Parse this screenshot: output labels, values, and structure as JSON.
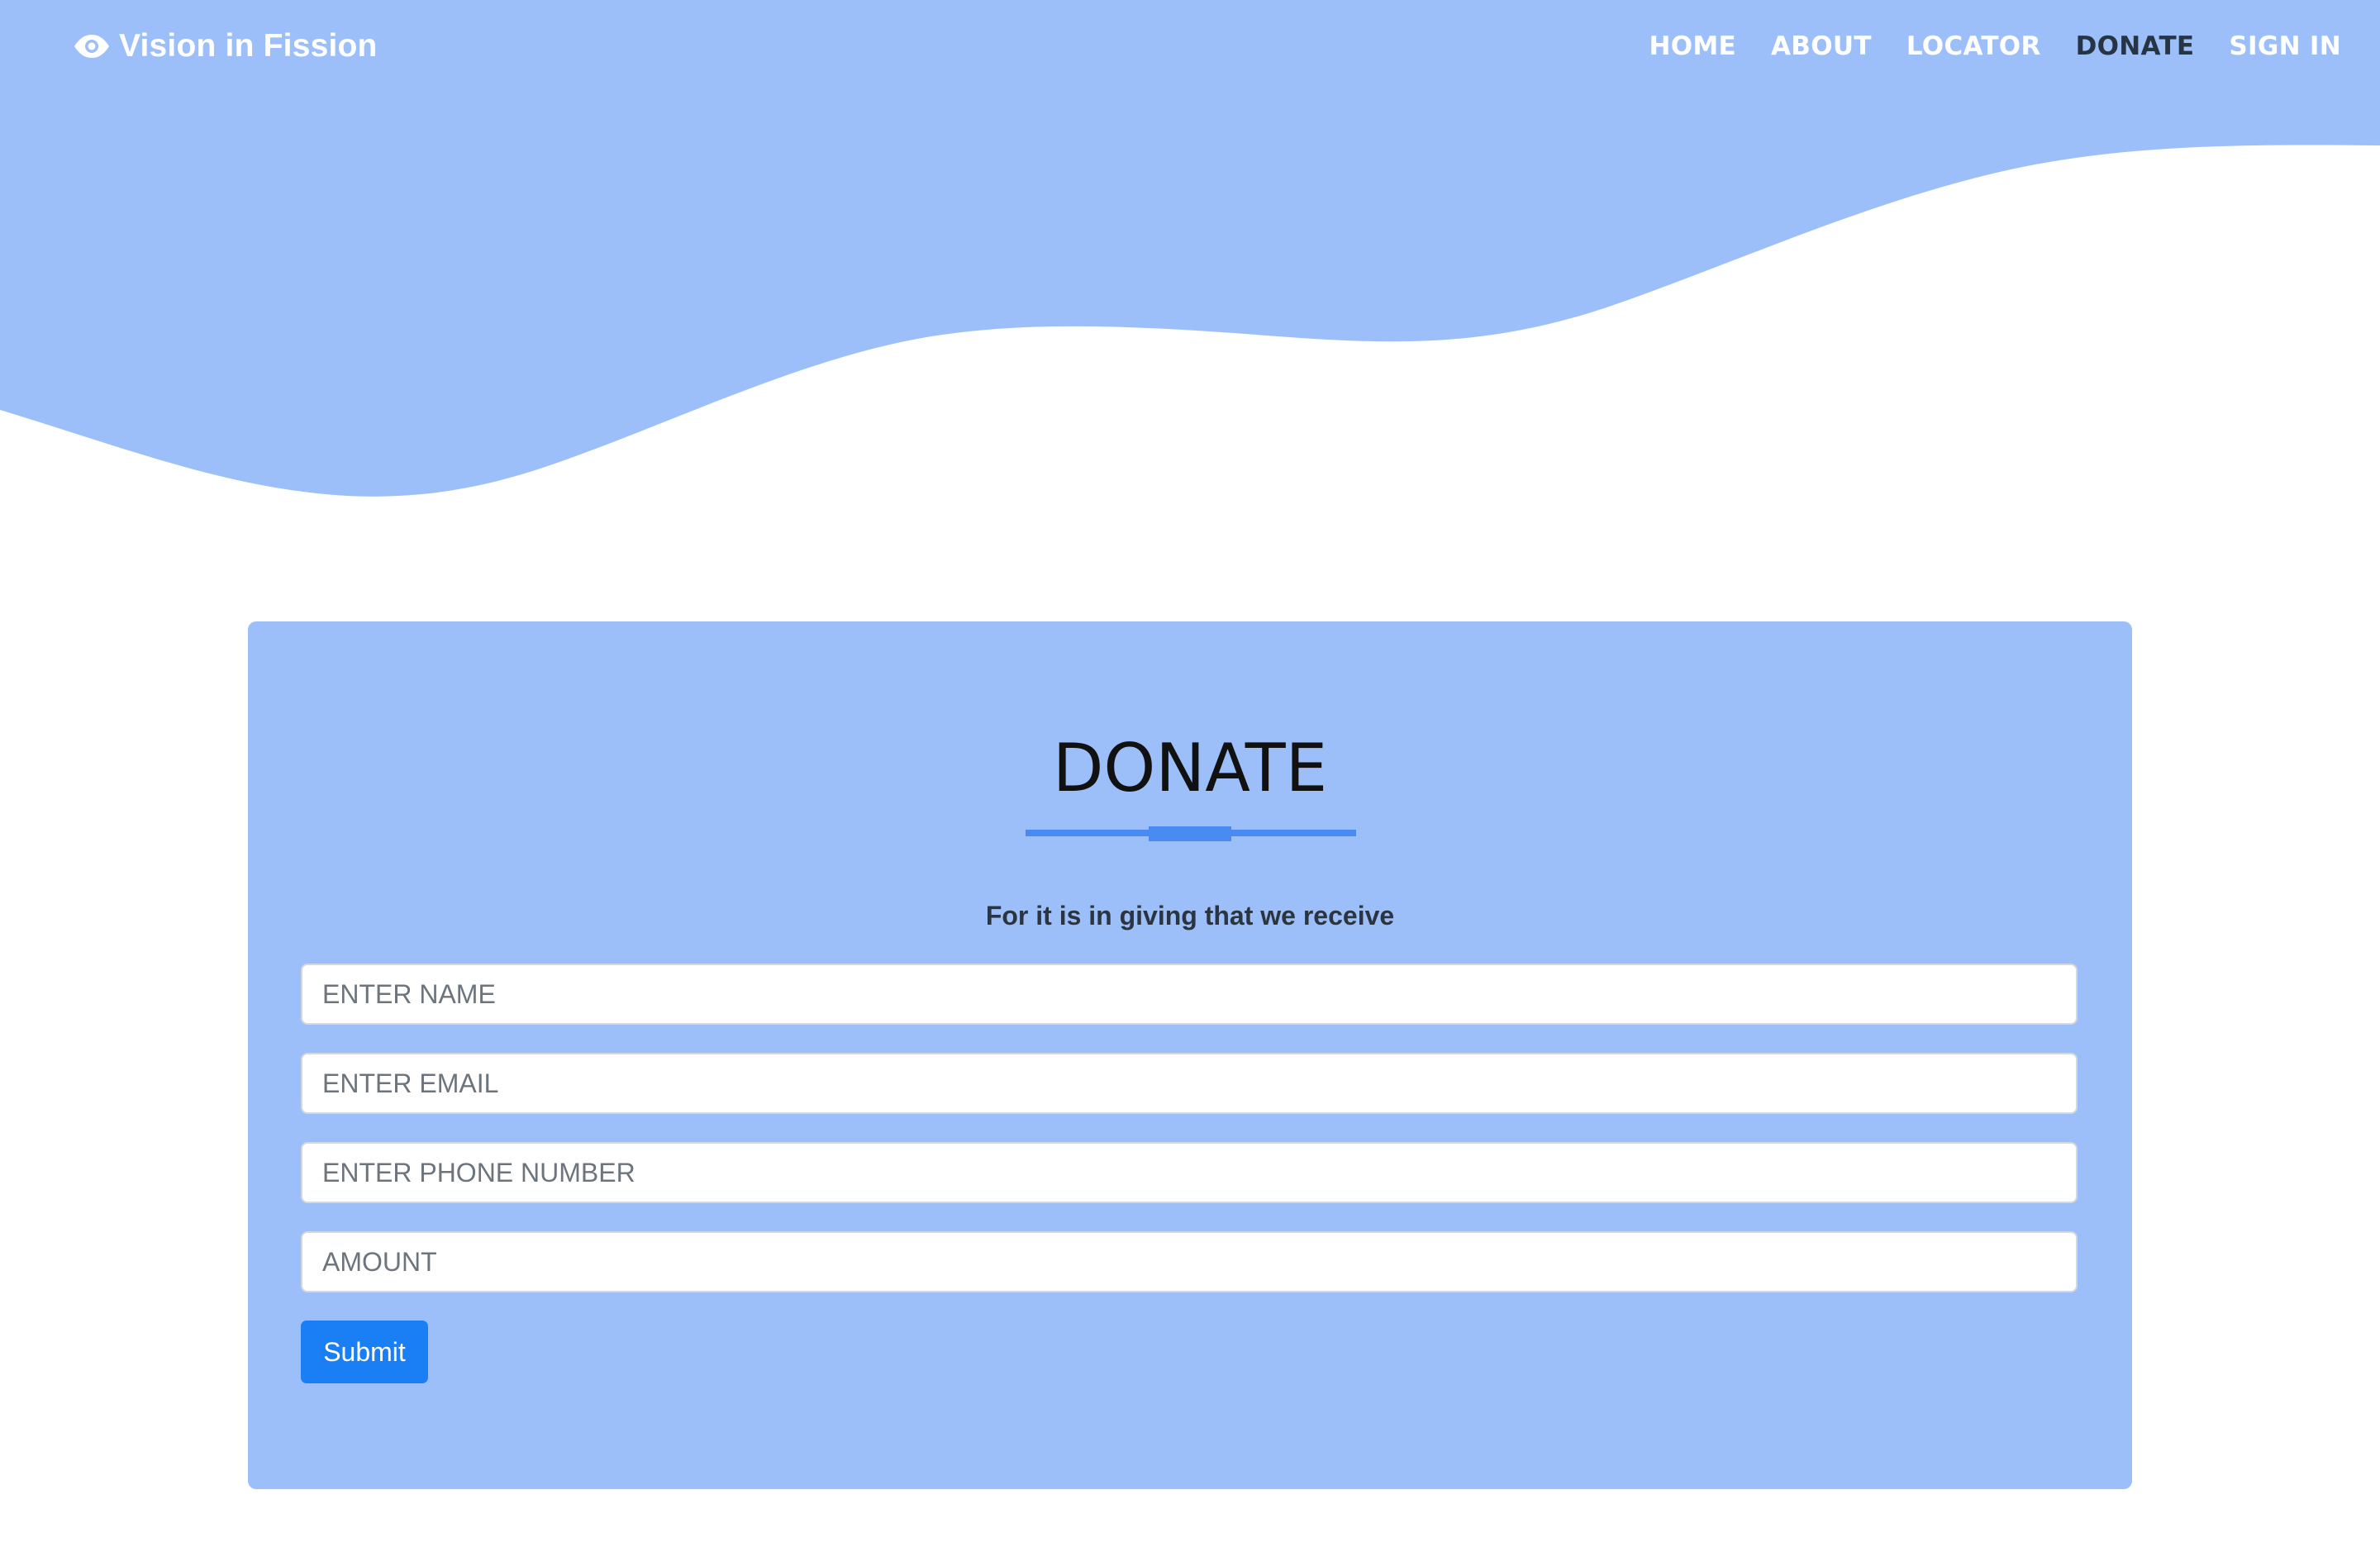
{
  "colors": {
    "accent": "#9dbff9",
    "nav_active": "#273443",
    "divider": "#4a8bf2",
    "submit": "#1a7ef5"
  },
  "navbar": {
    "brand": {
      "icon": "eye-icon",
      "text": "Vision in Fission"
    },
    "links": [
      {
        "label": "HOME",
        "active": false
      },
      {
        "label": "ABOUT",
        "active": false
      },
      {
        "label": "LOCATOR",
        "active": false
      },
      {
        "label": "DONATE",
        "active": true
      },
      {
        "label": "SIGN IN",
        "active": false
      }
    ]
  },
  "donate": {
    "title": "DONATE",
    "subtitle": "For it is in giving that we receive",
    "fields": {
      "name": {
        "placeholder": "ENTER NAME",
        "value": ""
      },
      "email": {
        "placeholder": "ENTER EMAIL",
        "value": ""
      },
      "phone": {
        "placeholder": "ENTER PHONE NUMBER",
        "value": ""
      },
      "amount": {
        "placeholder": "AMOUNT",
        "value": ""
      }
    },
    "submit_label": "Submit"
  }
}
